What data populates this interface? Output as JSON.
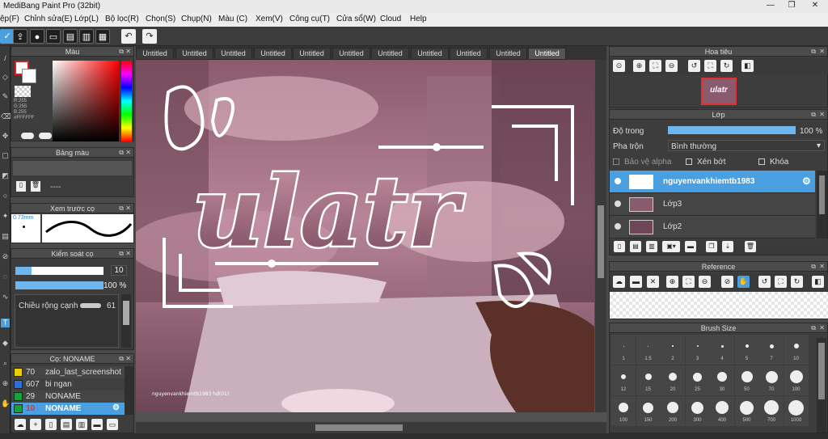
{
  "window": {
    "title": "MediBang Paint Pro (32bit)",
    "buttons": [
      "—",
      "❐",
      "✕"
    ]
  },
  "menu": [
    "ệp(F)",
    "Chỉnh sửa(E)",
    "Lớp(L)",
    "Bộ lọc(R)",
    "Chọn(S)",
    "Chụp(N)",
    "Màu (C)",
    "Xem(V)",
    "Công cụ(T)",
    "Cửa sổ(W)",
    "Cloud",
    "Help"
  ],
  "tabs": [
    "Untitled",
    "Untitled",
    "Untitled",
    "Untitled",
    "Untitled",
    "Untitled",
    "Untitled",
    "Untitled",
    "Untitled",
    "Untitled",
    "Untitled"
  ],
  "color_panel": {
    "title": "Màu",
    "r": "R:255",
    "g": "G:255",
    "b": "B:255",
    "hex": "#FFFFFF"
  },
  "palette_panel": {
    "title": "Bảng màu",
    "value": "----"
  },
  "preview_panel": {
    "title": "Xem trước cọ",
    "size": "0.73mm"
  },
  "brush_control": {
    "title": "Kiểm soát cọ",
    "size_value": "10",
    "opacity_value": "100 %",
    "width_label": "Chiều rộng cạnh",
    "width_value": "61"
  },
  "brush_list": {
    "title": "Cọ: NONAME",
    "items": [
      {
        "size": "70",
        "name": "zalo_last_screenshot",
        "color": "#e8d000"
      },
      {
        "size": "607",
        "name": "bi ngan",
        "color": "#2c6fd8"
      },
      {
        "size": "29",
        "name": "NONAME",
        "color": "#1aa03a"
      },
      {
        "size": "10",
        "name": "NONAME",
        "color": "#1aa03a",
        "selected": true
      }
    ]
  },
  "navigator": {
    "title": "Hoa tiêu",
    "thumb_text": "ulatr"
  },
  "layer_panel": {
    "title": "Lớp",
    "opacity_label": "Độ trong",
    "opacity_value": "100 %",
    "opacity_fraction": 1.0,
    "blend_label": "Pha trộn",
    "blend_value": "Bình thường",
    "protect_alpha": "Bảo vệ alpha",
    "clipping": "Xén bớt",
    "lock": "Khóa",
    "layers": [
      {
        "name": "nguyenvankhiemtb1983",
        "selected": true
      },
      {
        "name": "Lớp3",
        "selected": false
      },
      {
        "name": "Lớp2",
        "selected": false
      }
    ]
  },
  "reference_panel": {
    "title": "Reference"
  },
  "brush_size_panel": {
    "title": "Brush Size",
    "sizes": [
      "1",
      "1.5",
      "2",
      "3",
      "4",
      "5",
      "7",
      "10",
      "12",
      "15",
      "20",
      "25",
      "30",
      "50",
      "70",
      "100",
      "100",
      "150",
      "200",
      "300",
      "400",
      "500",
      "700",
      "1000"
    ]
  },
  "artwork": {
    "main_text": "ulatr",
    "signature": "nguyenvankhiemtb1983 hđ(01)"
  },
  "colors": {
    "accent": "#4a9fe0",
    "selected_layer": "#4a9fe0",
    "canvas_pink": "#a06f82"
  }
}
